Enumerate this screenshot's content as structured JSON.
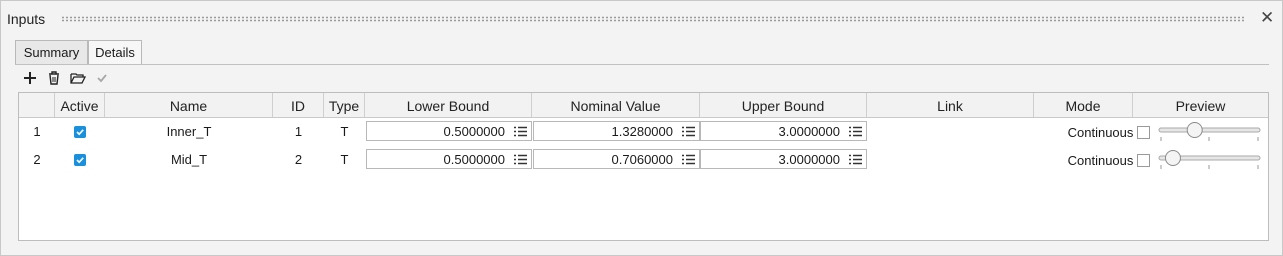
{
  "panel": {
    "title": "Inputs",
    "close_glyph": "✕"
  },
  "tabs": [
    {
      "label": "Summary",
      "active": false
    },
    {
      "label": "Details",
      "active": true
    }
  ],
  "toolbar": {
    "buttons": [
      {
        "name": "add-icon",
        "enabled": true
      },
      {
        "name": "trash-icon",
        "enabled": true
      },
      {
        "name": "folder-open-icon",
        "enabled": true
      },
      {
        "name": "checkmark-icon",
        "enabled": false
      }
    ]
  },
  "table": {
    "columns": [
      "",
      "Active",
      "Name",
      "ID",
      "Type",
      "Lower Bound",
      "Nominal Value",
      "Upper Bound",
      "Link",
      "Mode",
      "Preview"
    ],
    "rows": [
      {
        "index": "1",
        "active": true,
        "name": "Inner_T",
        "id": "1",
        "type": "T",
        "lower": "0.5000000",
        "nominal": "1.3280000",
        "upper": "3.0000000",
        "link": "",
        "mode": "Continuous",
        "preview_checked": false,
        "preview_fraction": 0.33
      },
      {
        "index": "2",
        "active": true,
        "name": "Mid_T",
        "id": "2",
        "type": "T",
        "lower": "0.5000000",
        "nominal": "0.7060000",
        "upper": "3.0000000",
        "link": "",
        "mode": "Continuous",
        "preview_checked": false,
        "preview_fraction": 0.08
      }
    ]
  },
  "colors": {
    "accent": "#1a8fdc",
    "panel_bg": "#f3f3f3",
    "table_bg": "#ffffff"
  }
}
